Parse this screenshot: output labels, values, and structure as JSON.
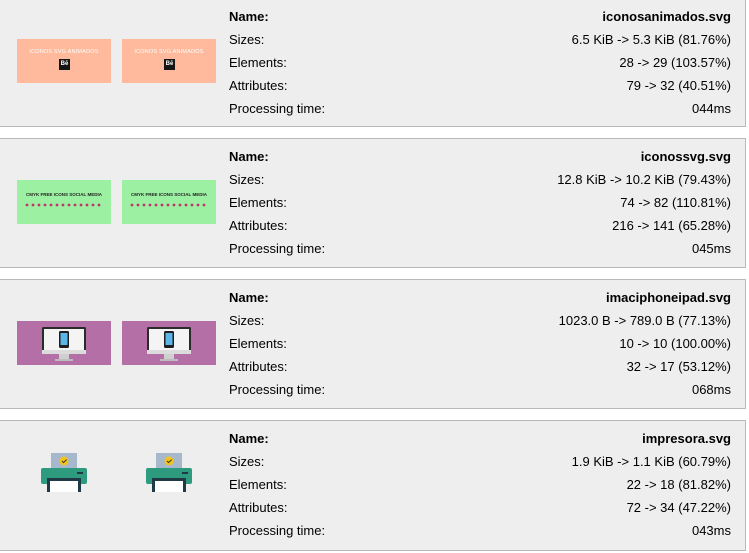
{
  "labels": {
    "name": "Name:",
    "sizes": "Sizes:",
    "elements": "Elements:",
    "attributes": "Attributes:",
    "processing": "Processing time:"
  },
  "files": [
    {
      "name": "iconosanimados.svg",
      "sizes": "6.5 KiB -> 5.3 KiB (81.76%)",
      "elements": "28 -> 29 (103.57%)",
      "attributes": "79 -> 32 (40.51%)",
      "processing": "044ms",
      "thumb_text": "ICONOS SVG ANIMADOS",
      "thumb_badge": "Bē",
      "thumb_color": "#ffb99c"
    },
    {
      "name": "iconossvg.svg",
      "sizes": "12.8 KiB -> 10.2 KiB (79.43%)",
      "elements": "74 -> 82 (110.81%)",
      "attributes": "216 -> 141 (65.28%)",
      "processing": "045ms",
      "thumb_text": "CMYK FREE ICONS SOCIAL MEDIA",
      "thumb_color": "#9bf0a2"
    },
    {
      "name": "imaciphoneipad.svg",
      "sizes": "1023.0 B -> 789.0 B (77.13%)",
      "elements": "10 -> 10 (100.00%)",
      "attributes": "32 -> 17 (53.12%)",
      "processing": "068ms",
      "thumb_color": "#b36fa6"
    },
    {
      "name": "impresora.svg",
      "sizes": "1.9 KiB -> 1.1 KiB (60.79%)",
      "elements": "22 -> 18 (81.82%)",
      "attributes": "72 -> 34 (47.22%)",
      "processing": "043ms",
      "thumb_color": "#2f9a7e"
    }
  ],
  "colors": {
    "card_bg": "#eeeeee",
    "card_border": "#b9b9b9"
  }
}
